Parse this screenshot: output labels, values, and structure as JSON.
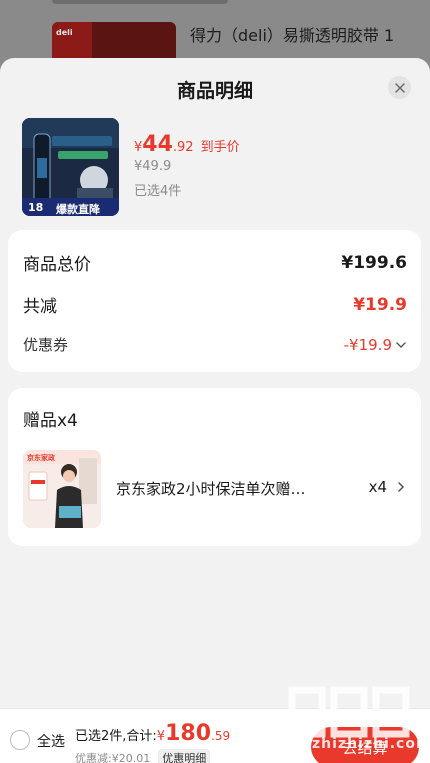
{
  "background": {
    "product_title": "得力（deli）易撕透明胶带 1",
    "brand_tag": "deli"
  },
  "sheet": {
    "title": "商品明细",
    "close_icon": "close-icon"
  },
  "product": {
    "currency": "¥",
    "price_int": "44",
    "price_dec": ".92",
    "price_tip": "到手价",
    "original_price": "¥49.9",
    "selected_count": "已选4件",
    "thumb_caption": "爆款直降",
    "thumb_badge": "18"
  },
  "summary": {
    "total_label": "商品总价",
    "total_value": "¥199.6",
    "reduce_label": "共减",
    "reduce_value": "¥19.9",
    "coupon_label": "优惠券",
    "coupon_value": "-¥19.9",
    "coupon_icon": "chevron-down-icon"
  },
  "gift": {
    "title": "赠品x4",
    "name": "京东家政2小时保洁单次赠…",
    "qty": "x4",
    "thumb_tag": "京东家政",
    "chevron_icon": "chevron-right-icon"
  },
  "bottom_bar": {
    "select_all": "全选",
    "selected_total_label": "已选2件,合计:",
    "currency": "¥",
    "total_int": "180",
    "total_dec": ".59",
    "reduced_text": "优惠减:¥20.01",
    "detail_button": "优惠明细",
    "checkout_button": "去结算"
  },
  "watermark": {
    "logo": "值值值",
    "site": "zhizhizhi.com"
  },
  "colors": {
    "accent": "#e8392c",
    "sheet_bg": "#f2f2f2",
    "card_bg": "#ffffff",
    "muted": "#8b8b8b"
  }
}
